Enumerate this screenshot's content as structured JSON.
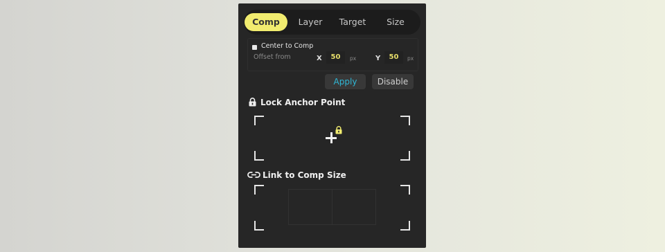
{
  "tabs": [
    {
      "label": "Comp",
      "active": true
    },
    {
      "label": "Layer",
      "active": false
    },
    {
      "label": "Target",
      "active": false
    },
    {
      "label": "Size",
      "active": false
    }
  ],
  "offset": {
    "center_label": "Center to Comp",
    "offset_from_label": "Offset from",
    "x_label": "X",
    "x_value": "50",
    "x_unit": "px",
    "y_label": "Y",
    "y_value": "50",
    "y_unit": "px"
  },
  "buttons": {
    "apply": "Apply",
    "disable": "Disable"
  },
  "anchor": {
    "title": "Lock Anchor Point"
  },
  "link": {
    "title": "Link to Comp Size"
  },
  "colors": {
    "accent_yellow": "#f1ec6f",
    "apply_blue": "#2fb7d6",
    "panel_bg": "#262626"
  },
  "icons": [
    "lock-icon",
    "small-lock-icon",
    "link-icon",
    "crosshair-icon"
  ]
}
